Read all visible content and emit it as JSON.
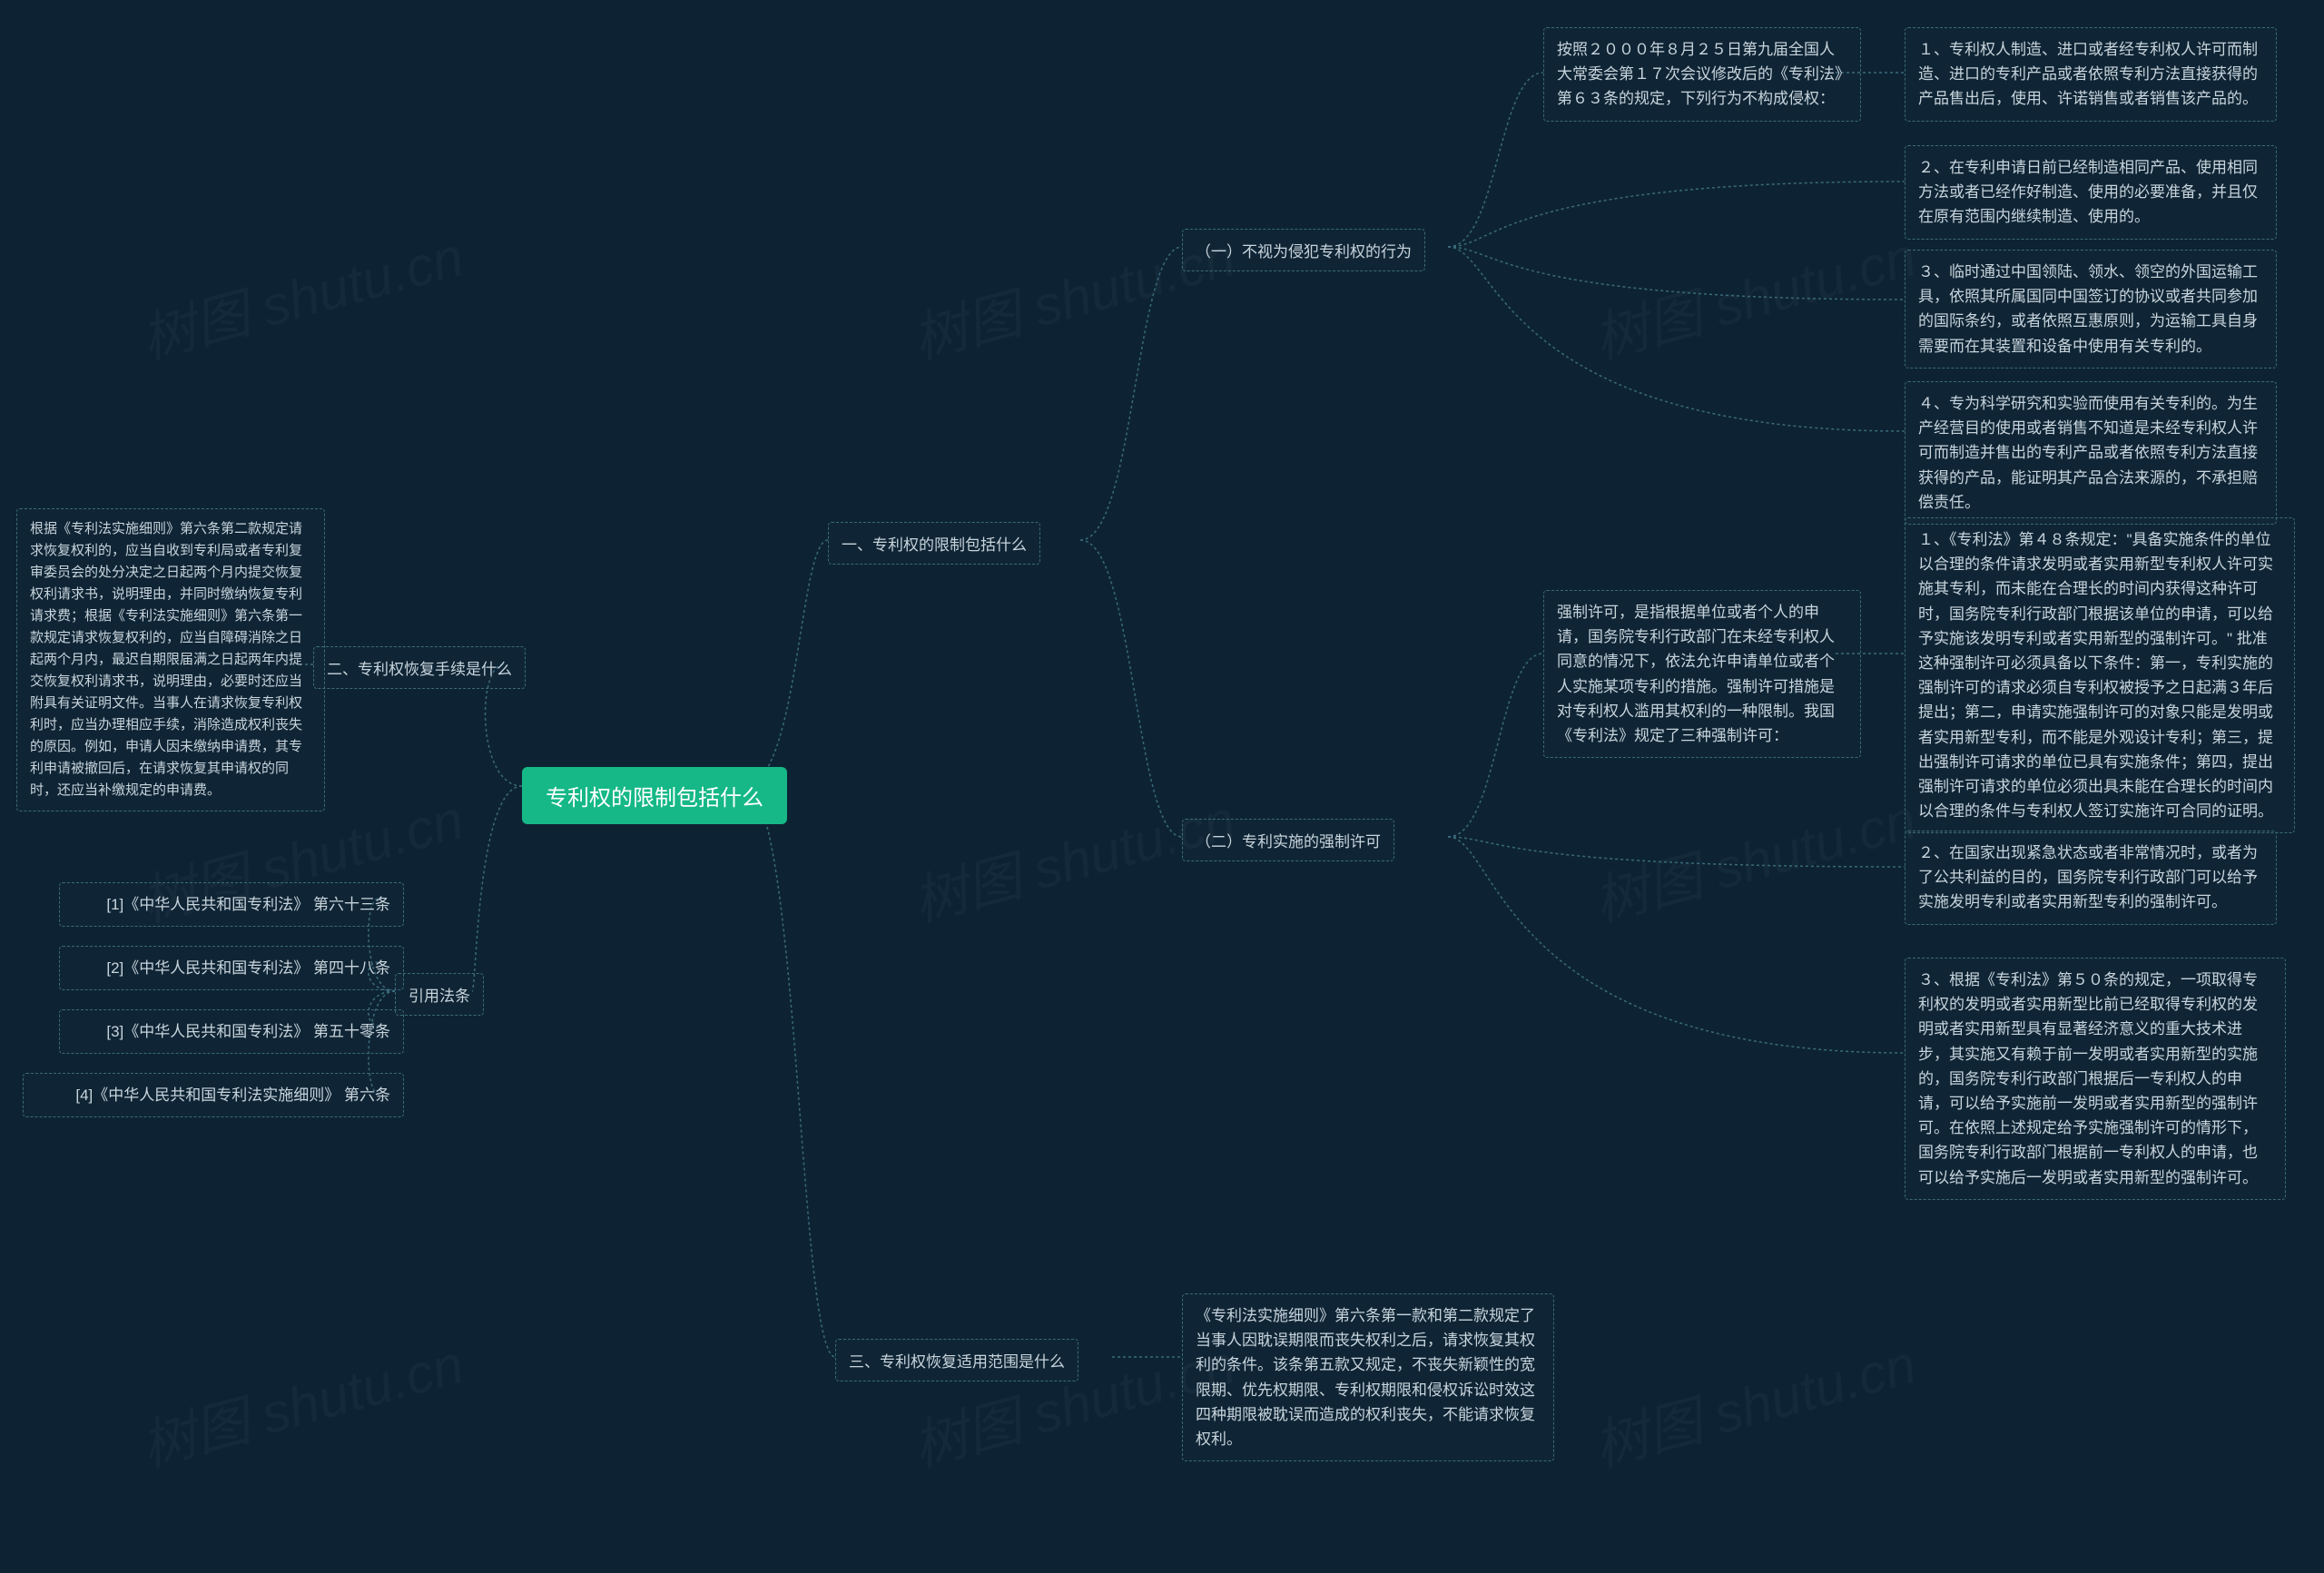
{
  "watermark": "树图 shutu.cn",
  "root": "专利权的限制包括什么",
  "right": {
    "b1": {
      "label": "一、专利权的限制包括什么",
      "s1": {
        "label": "（一）不视为侵犯专利权的行为",
        "intro": "按照２０００年８月２５日第九届全国人大常委会第１７次会议修改后的《专利法》第６３条的规定，下列行为不构成侵权：",
        "items": [
          "１、专利权人制造、进口或者经专利权人许可而制造、进口的专利产品或者依照专利方法直接获得的产品售出后，使用、许诺销售或者销售该产品的。",
          "２、在专利申请日前已经制造相同产品、使用相同方法或者已经作好制造、使用的必要准备，并且仅在原有范围内继续制造、使用的。",
          "３、临时通过中国领陆、领水、领空的外国运输工具，依照其所属国同中国签订的协议或者共同参加的国际条约，或者依照互惠原则，为运输工具自身需要而在其装置和设备中使用有关专利的。",
          "４、专为科学研究和实验而使用有关专利的。为生产经营目的使用或者销售不知道是未经专利权人许可而制造并售出的专利产品或者依照专利方法直接获得的产品，能证明其产品合法来源的，不承担赔偿责任。"
        ]
      },
      "s2": {
        "label": "（二）专利实施的强制许可",
        "intro": "强制许可，是指根据单位或者个人的申请，国务院专利行政部门在未经专利权人同意的情况下，依法允许申请单位或者个人实施某项专利的措施。强制许可措施是对专利权人滥用其权利的一种限制。我国《专利法》规定了三种强制许可：",
        "items": [
          "１、《专利法》第４８条规定：\"具备实施条件的单位以合理的条件请求发明或者实用新型专利权人许可实施其专利，而未能在合理长的时间内获得这种许可时，国务院专利行政部门根据该单位的申请，可以给予实施该发明专利或者实用新型的强制许可。\" 批准这种强制许可必须具备以下条件：第一，专利实施的强制许可的请求必须自专利权被授予之日起满３年后提出；第二，申请实施强制许可的对象只能是发明或者实用新型专利，而不能是外观设计专利；第三，提出强制许可请求的单位已具有实施条件；第四，提出强制许可请求的单位必须出具未能在合理长的时间内以合理的条件与专利权人签订实施许可合同的证明。",
          "２、在国家出现紧急状态或者非常情况时，或者为了公共利益的目的，国务院专利行政部门可以给予实施发明专利或者实用新型专利的强制许可。",
          "３、根据《专利法》第５０条的规定，一项取得专利权的发明或者实用新型比前已经取得专利权的发明或者实用新型具有显著经济意义的重大技术进步，其实施又有赖于前一发明或者实用新型的实施的，国务院专利行政部门根据后一专利权人的申请，可以给予实施前一发明或者实用新型的强制许可。在依照上述规定给予实施强制许可的情形下，国务院专利行政部门根据前一专利权人的申请，也可以给予实施后一发明或者实用新型的强制许可。"
        ]
      }
    },
    "b3": {
      "label": "三、专利权恢复适用范围是什么",
      "content": "《专利法实施细则》第六条第一款和第二款规定了当事人因耽误期限而丧失权利之后，请求恢复其权利的条件。该条第五款又规定，不丧失新颖性的宽限期、优先权期限、专利权期限和侵权诉讼时效这四种期限被耽误而造成的权利丧失，不能请求恢复权利。"
    }
  },
  "left": {
    "b2": {
      "label": "二、专利权恢复手续是什么",
      "content": "根据《专利法实施细则》第六条第二款规定请求恢复权利的，应当自收到专利局或者专利复审委员会的处分决定之日起两个月内提交恢复权利请求书，说明理由，并同时缴纳恢复专利请求费；根据《专利法实施细则》第六条第一款规定请求恢复权利的，应当自障碍消除之日起两个月内，最迟自期限届满之日起两年内提交恢复权利请求书，说明理由，必要时还应当附具有关证明文件。当事人在请求恢复专利权利时，应当办理相应手续，消除造成权利丧失的原因。例如，申请人因未缴纳申请费，其专利申请被撤回后，在请求恢复其申请权的同时，还应当补缴规定的申请费。"
    },
    "b4": {
      "label": "引用法条",
      "items": [
        "[1]《中华人民共和国专利法》 第六十三条",
        "[2]《中华人民共和国专利法》 第四十八条",
        "[3]《中华人民共和国专利法》 第五十零条",
        "[4]《中华人民共和国专利法实施细则》 第六条"
      ]
    }
  }
}
